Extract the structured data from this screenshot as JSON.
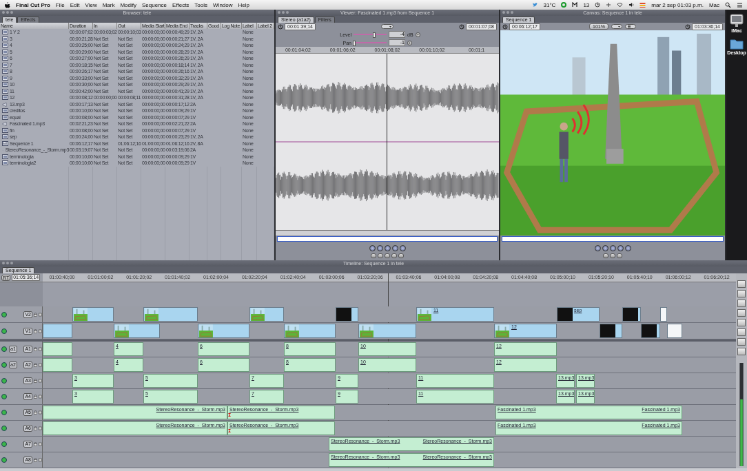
{
  "menu_bar": {
    "app": "Final Cut Pro",
    "menus": [
      "File",
      "Edit",
      "View",
      "Mark",
      "Modify",
      "Sequence",
      "Effects",
      "Tools",
      "Window",
      "Help"
    ],
    "weather": "31°C",
    "mail_count": "13",
    "clock": "mar 2 sep 01:03 p.m.",
    "user": "Mac"
  },
  "browser": {
    "title": "Browser: tele",
    "tabs": [
      {
        "label": "tele",
        "selected": true
      },
      {
        "label": "Effects",
        "selected": false
      }
    ],
    "columns": [
      "Name",
      "Duration",
      "In",
      "Out",
      "Media Start",
      "Media End",
      "Tracks",
      "Good",
      "Log Note",
      "Label",
      "Label 2"
    ],
    "rows": [
      {
        "kind": "clip",
        "cells": [
          "1 Y 2",
          "00:00:07;02",
          "00:00:03;02",
          "00:00:10;03",
          "00:00:00;00",
          "00:00:49;29",
          "1V, 2A",
          "None"
        ]
      },
      {
        "kind": "clip",
        "cells": [
          "3",
          "00:00:21;28",
          "Not Set",
          "Not Set",
          "00:00:00;00",
          "00:00:21;27",
          "1V, 2A",
          "None"
        ]
      },
      {
        "kind": "clip",
        "cells": [
          "4",
          "00:00:25;00",
          "Not Set",
          "Not Set",
          "00:00:00;00",
          "00:00:24;29",
          "1V, 2A",
          "None"
        ]
      },
      {
        "kind": "clip",
        "cells": [
          "5",
          "00:00:29;00",
          "Not Set",
          "Not Set",
          "00:00:00;00",
          "00:00:28;29",
          "1V, 2A",
          "None"
        ]
      },
      {
        "kind": "clip",
        "cells": [
          "6",
          "00:00:27;00",
          "Not Set",
          "Not Set",
          "00:00:00;00",
          "00:00:26;29",
          "1V, 2A",
          "None"
        ]
      },
      {
        "kind": "clip",
        "cells": [
          "7",
          "00:00:18;15",
          "Not Set",
          "Not Set",
          "00:00:00;00",
          "00:00:18;14",
          "1V, 2A",
          "None"
        ]
      },
      {
        "kind": "clip",
        "cells": [
          "8",
          "00:00:26;17",
          "Not Set",
          "Not Set",
          "00:00:00;00",
          "00:00:26;16",
          "1V, 2A",
          "None"
        ]
      },
      {
        "kind": "clip",
        "cells": [
          "9",
          "00:00:33;00",
          "Not Set",
          "Not Set",
          "00:00:00;00",
          "00:00:32;29",
          "1V, 2A",
          "None"
        ]
      },
      {
        "kind": "clip",
        "cells": [
          "10",
          "00:00:30;00",
          "Not Set",
          "Not Set",
          "00:00:00;00",
          "00:00:29;29",
          "1V, 2A",
          "None"
        ]
      },
      {
        "kind": "clip",
        "cells": [
          "11",
          "00:00:42;00",
          "Not Set",
          "Not Set",
          "00:00:00;00",
          "00:00:41;29",
          "1V, 2A",
          "None"
        ]
      },
      {
        "kind": "clip",
        "cells": [
          "12",
          "00:00:08;12",
          "00:00:00;00",
          "00:00:08;11",
          "00:00:00;00",
          "00:00:31;28",
          "1V, 2A",
          "None"
        ]
      },
      {
        "kind": "audio",
        "cells": [
          "13.mp3",
          "00:00:17;13",
          "Not Set",
          "Not Set",
          "00:00:00;00",
          "00:00:17;12",
          "2A",
          "None"
        ]
      },
      {
        "kind": "clip",
        "cells": [
          "creditos",
          "00:00:10;00",
          "Not Set",
          "Not Set",
          "00:00:00;00",
          "00:00:09;29",
          "1V",
          "None"
        ]
      },
      {
        "kind": "clip",
        "cells": [
          "equal",
          "00:00:08;00",
          "Not Set",
          "Not Set",
          "00:00:00;00",
          "00:00:07;29",
          "1V",
          "None"
        ]
      },
      {
        "kind": "audio",
        "cells": [
          "Fascinated 1.mp3",
          "00:02:21;23",
          "Not Set",
          "Not Set",
          "00:00:00;00",
          "00:02:21;22",
          "2A",
          "None"
        ]
      },
      {
        "kind": "clip",
        "cells": [
          "fin",
          "00:00:08;00",
          "Not Set",
          "Not Set",
          "00:00:00;00",
          "00:00:07;29",
          "1V",
          "None"
        ]
      },
      {
        "kind": "clip",
        "cells": [
          "sep",
          "00:00:24;00",
          "Not Set",
          "Not Set",
          "00:00:00;00",
          "00:00:23;29",
          "1V, 2A",
          "None"
        ]
      },
      {
        "kind": "sequence",
        "cells": [
          "Sequence 1",
          "00:06:12;17",
          "Not Set",
          "01:06:12;16",
          "01:00:00;00",
          "01:06:12;16",
          "2V, 8A",
          "None"
        ]
      },
      {
        "kind": "audio",
        "cells": [
          "StereoResonance_-_Storm.mp3",
          "00:03:19;07",
          "Not Set",
          "Not Set",
          "00:00:00;00",
          "00:03:19;06",
          "2A",
          "None"
        ]
      },
      {
        "kind": "clip",
        "cells": [
          "terminologia",
          "00:00:10;00",
          "Not Set",
          "Not Set",
          "00:00:00;00",
          "00:00:09;29",
          "1V",
          "None"
        ]
      },
      {
        "kind": "clip",
        "cells": [
          "terminologia2",
          "00:00:10;00",
          "Not Set",
          "Not Set",
          "00:00:00;00",
          "00:00:09;29",
          "1V",
          "None"
        ]
      }
    ]
  },
  "viewer": {
    "title": "Viewer: Fascinated 1.mp3 from Sequence 1",
    "tabs": [
      {
        "label": "Stereo (a1a2)",
        "selected": true
      },
      {
        "label": "Filters",
        "selected": false
      }
    ],
    "duration": "00:01:39;14",
    "current": "00:01:07;08",
    "level_label": "Level",
    "level_value": "-4",
    "level_unit": "dB",
    "level_slider": {
      "level": 0.62
    },
    "pan_label": "Pan",
    "pan_value": "-1",
    "pan_slider": {
      "level": 0.02
    },
    "ruler": [
      "00:01:04;02",
      "00:01:06;02",
      "00:01:08;02",
      "00:01:10;02",
      "00:01:1"
    ]
  },
  "canvas": {
    "title": "Canvas: Sequence 1 in tele",
    "tabs": [
      {
        "label": "Sequence 1",
        "selected": true
      }
    ],
    "current": "00:06:12;17",
    "zoom": "101%",
    "duration": "01:03:36;14"
  },
  "desktop": {
    "items": [
      "iMac",
      "Desktop"
    ]
  },
  "timeline": {
    "title": "Timeline: Sequence 1 in tele",
    "tabs": [
      {
        "label": "Sequence 1",
        "selected": true
      }
    ],
    "rt": "RT",
    "timecode": "01:05:36;14",
    "ruler": [
      "01:00:40;00",
      "01:01:00;02",
      "01:01:20;02",
      "01:01:40;02",
      "01:02:00;04",
      "01:02:20;04",
      "01:02:40;04",
      "01:03:00;06",
      "01:03:20;06",
      "01:03:40;06",
      "01:04:00;08",
      "01:04:20;08",
      "01:04:40;08",
      "01:05:00;10",
      "01:05:20;10",
      "01:05:40;10",
      "01:06:00;12",
      "01:06:20;12"
    ],
    "tracks": [
      {
        "name": "V2",
        "kind": "video",
        "clips": [
          {
            "kind": "thumb"
          },
          {
            "kind": "thumb"
          },
          {
            "kind": "thumb"
          },
          {
            "kind": "dark"
          },
          {
            "kind": "thumb",
            "label": "11"
          },
          {
            "kind": "dark",
            "label": "sep"
          },
          {
            "kind": "dark"
          },
          {
            "kind": "white"
          }
        ]
      },
      {
        "name": "V1",
        "kind": "video",
        "clips": [
          {
            "kind": "plain"
          },
          {
            "kind": "thumb"
          },
          {
            "kind": "thumb"
          },
          {
            "kind": "thumb"
          },
          {
            "kind": "thumb"
          },
          {
            "kind": "thumb",
            "label": "12"
          },
          {
            "kind": "dark"
          },
          {
            "kind": "dark"
          },
          {
            "kind": "white"
          }
        ]
      },
      {
        "name": "A1",
        "source": "a1",
        "kind": "audio",
        "clips": [
          {
            "kind": "audio"
          },
          {
            "kind": "audio",
            "labels": [
              "4"
            ]
          },
          {
            "kind": "audio",
            "labels": [
              "6"
            ]
          },
          {
            "kind": "audio",
            "labels": [
              "8"
            ]
          },
          {
            "kind": "audio",
            "labels": [
              "10"
            ]
          },
          {
            "kind": "audio",
            "labels": [
              "12"
            ]
          }
        ]
      },
      {
        "name": "A2",
        "source": "a2",
        "kind": "audio",
        "clips": [
          {
            "kind": "audio"
          },
          {
            "kind": "audio",
            "labels": [
              "4"
            ]
          },
          {
            "kind": "audio",
            "labels": [
              "6"
            ]
          },
          {
            "kind": "audio",
            "labels": [
              "8"
            ]
          },
          {
            "kind": "audio",
            "labels": [
              "10"
            ]
          },
          {
            "kind": "audio",
            "labels": [
              "12"
            ]
          }
        ]
      },
      {
        "name": "A3",
        "kind": "audio",
        "clips": [
          {
            "kind": "audio",
            "labels": [
              "3"
            ]
          },
          {
            "kind": "audio",
            "labels": [
              "5"
            ]
          },
          {
            "kind": "audio",
            "labels": [
              "7"
            ]
          },
          {
            "kind": "audio",
            "labels": [
              "9"
            ]
          },
          {
            "kind": "audio",
            "labels": [
              "11"
            ]
          },
          {
            "kind": "audio",
            "labels": [
              "13.mp3"
            ]
          },
          {
            "kind": "audio",
            "labels": [
              "13.mp3"
            ]
          }
        ]
      },
      {
        "name": "A4",
        "kind": "audio",
        "clips": [
          {
            "kind": "audio",
            "labels": [
              "3"
            ]
          },
          {
            "kind": "audio",
            "labels": [
              "5"
            ]
          },
          {
            "kind": "audio",
            "labels": [
              "7"
            ]
          },
          {
            "kind": "audio",
            "labels": [
              "9"
            ]
          },
          {
            "kind": "audio",
            "labels": [
              "11"
            ]
          },
          {
            "kind": "audio",
            "labels": [
              "13.mp3"
            ]
          },
          {
            "kind": "audio",
            "labels": [
              "13.mp3"
            ]
          }
        ]
      },
      {
        "name": "A5",
        "kind": "audio",
        "clips": [
          {
            "kind": "audio",
            "labels": [
              "StereoResonance_-_Storm.mp3"
            ]
          },
          {
            "kind": "audio",
            "labels": [
              "StereoResonance_-_Storm.mp3"
            ],
            "edit_marker": true
          },
          {
            "kind": "audio",
            "labels": [
              "Fascinated 1.mp3",
              "Fascinated 1.mp3"
            ]
          }
        ]
      },
      {
        "name": "A6",
        "kind": "audio",
        "clips": [
          {
            "kind": "audio",
            "labels": [
              "StereoResonance_-_Storm.mp3"
            ]
          },
          {
            "kind": "audio",
            "labels": [
              "StereoResonance_-_Storm.mp3"
            ],
            "edit_marker": true
          },
          {
            "kind": "audio",
            "labels": [
              "Fascinated 1.mp3",
              "Fascinated 1.mp3"
            ]
          }
        ]
      },
      {
        "name": "A7",
        "kind": "audio",
        "clips": [
          {
            "kind": "audio",
            "labels": [
              "StereoResonance_-_Storm.mp3",
              "StereoResonance_-_Storm.mp3"
            ]
          }
        ]
      },
      {
        "name": "A8",
        "kind": "audio",
        "clips": [
          {
            "kind": "audio",
            "labels": [
              "StereoResonance_-_Storm.mp3",
              "StereoResonance_-_Storm.mp3"
            ]
          }
        ]
      }
    ]
  }
}
